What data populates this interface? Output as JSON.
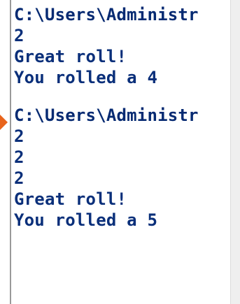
{
  "console": {
    "blocks": [
      {
        "lines": [
          "C:\\Users\\Administr",
          "2",
          "Great roll!",
          "You rolled a 4"
        ]
      },
      {
        "lines": [
          "C:\\Users\\Administr",
          "2",
          "2",
          "2",
          "Great roll!",
          "You rolled a 5"
        ]
      }
    ]
  },
  "colors": {
    "text": "#0a2f7a",
    "background": "#ffffff",
    "arrow": "#e8641c"
  },
  "icons": {
    "marker": "orange-arrow-icon"
  }
}
